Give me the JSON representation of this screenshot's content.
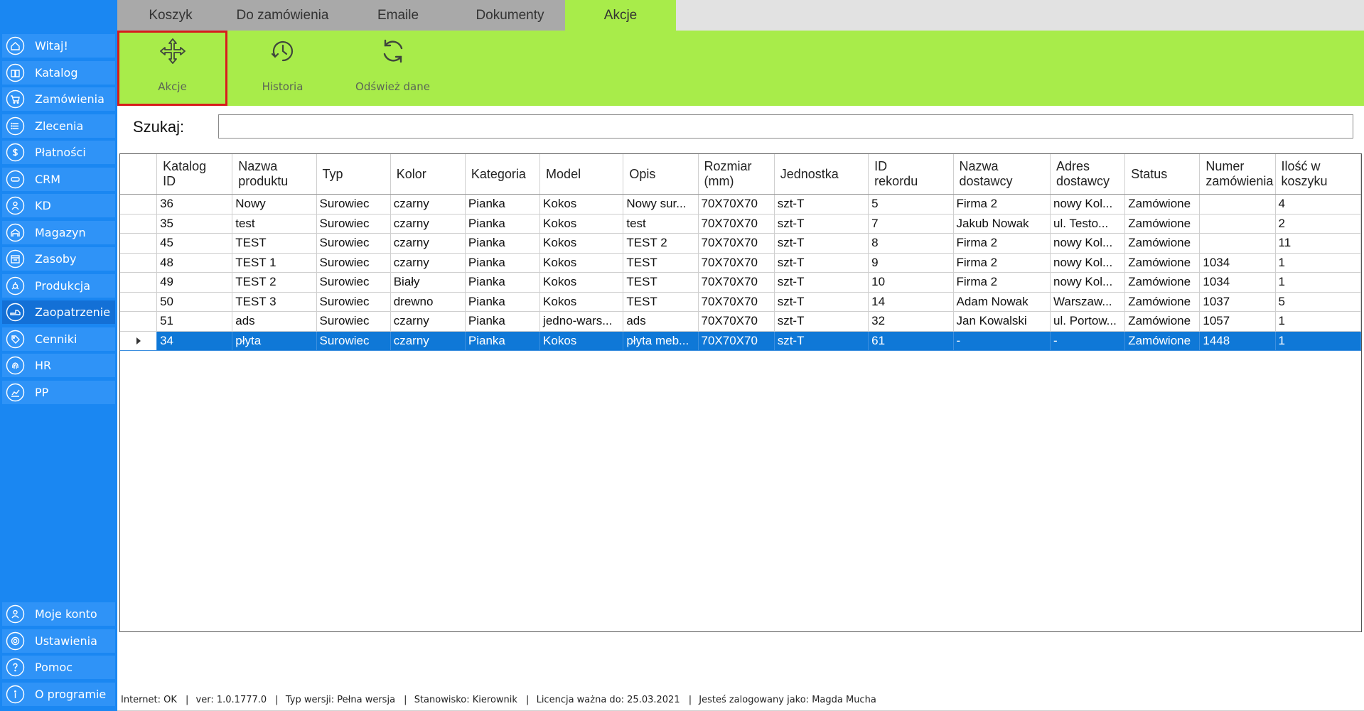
{
  "sidebar": {
    "top_items": [
      {
        "label": "Witaj!",
        "icon": "home-icon"
      },
      {
        "label": "Katalog",
        "icon": "book-icon"
      },
      {
        "label": "Zamówienia",
        "icon": "cart-icon"
      },
      {
        "label": "Zlecenia",
        "icon": "list-icon"
      },
      {
        "label": "Płatności",
        "icon": "dollar-icon"
      },
      {
        "label": "CRM",
        "icon": "crm-icon"
      },
      {
        "label": "KD",
        "icon": "user-icon"
      },
      {
        "label": "Magazyn",
        "icon": "warehouse-icon"
      },
      {
        "label": "Zasoby",
        "icon": "resources-icon"
      },
      {
        "label": "Produkcja",
        "icon": "production-icon"
      },
      {
        "label": "Zaopatrzenie",
        "icon": "supply-icon"
      },
      {
        "label": "Cenniki",
        "icon": "price-tag-icon"
      },
      {
        "label": "HR",
        "icon": "fingerprint-icon"
      },
      {
        "label": "PP",
        "icon": "chart-icon"
      }
    ],
    "bottom_items": [
      {
        "label": "Moje konto",
        "icon": "account-icon"
      },
      {
        "label": "Ustawienia",
        "icon": "settings-icon"
      },
      {
        "label": "Pomoc",
        "icon": "help-icon"
      },
      {
        "label": "O programie",
        "icon": "info-icon"
      }
    ],
    "active_item": "Zaopatrzenie"
  },
  "tabs": [
    "Koszyk",
    "Do zamówienia",
    "Emaile",
    "Dokumenty",
    "Akcje"
  ],
  "active_tab": "Akcje",
  "toolbar": {
    "buttons": [
      {
        "label": "Akcje",
        "icon": "move-arrows-icon"
      },
      {
        "label": "Historia",
        "icon": "history-icon"
      },
      {
        "label": "Odśwież dane",
        "icon": "refresh-icon"
      }
    ]
  },
  "search": {
    "label": "Szukaj:",
    "value": ""
  },
  "grid": {
    "columns": [
      {
        "line1": "Katalog",
        "line2": "ID"
      },
      {
        "line1": "Nazwa",
        "line2": "produktu"
      },
      {
        "line1": "Typ",
        "line2": ""
      },
      {
        "line1": "Kolor",
        "line2": ""
      },
      {
        "line1": "Kategoria",
        "line2": ""
      },
      {
        "line1": "Model",
        "line2": ""
      },
      {
        "line1": "Opis",
        "line2": ""
      },
      {
        "line1": "Rozmiar",
        "line2": "(mm)"
      },
      {
        "line1": "Jednostka",
        "line2": ""
      },
      {
        "line1": "ID",
        "line2": "rekordu"
      },
      {
        "line1": "Nazwa",
        "line2": "dostawcy"
      },
      {
        "line1": "Adres",
        "line2": "dostawcy"
      },
      {
        "line1": "Status",
        "line2": ""
      },
      {
        "line1": "Numer",
        "line2": "zamówienia"
      },
      {
        "line1": "Ilość w",
        "line2": "koszyku"
      }
    ],
    "rows": [
      [
        "36",
        "Nowy",
        "Surowiec",
        "czarny",
        "Pianka",
        "Kokos",
        "Nowy sur...",
        "70X70X70",
        "szt-T",
        "5",
        "Firma 2",
        "nowy Kol...",
        "Zamówione",
        "",
        "4"
      ],
      [
        "35",
        "test",
        "Surowiec",
        "czarny",
        "Pianka",
        "Kokos",
        "test",
        "70X70X70",
        "szt-T",
        "7",
        "Jakub Nowak",
        "ul. Testo...",
        "Zamówione",
        "",
        "2"
      ],
      [
        "45",
        "TEST",
        "Surowiec",
        "czarny",
        "Pianka",
        "Kokos",
        "TEST 2",
        "70X70X70",
        "szt-T",
        "8",
        "Firma 2",
        "nowy Kol...",
        "Zamówione",
        "",
        "11"
      ],
      [
        "48",
        "TEST 1",
        "Surowiec",
        "czarny",
        "Pianka",
        "Kokos",
        "TEST",
        "70X70X70",
        "szt-T",
        "9",
        "Firma 2",
        "nowy Kol...",
        "Zamówione",
        "1034",
        "1"
      ],
      [
        "49",
        "TEST 2",
        "Surowiec",
        "Biały",
        "Pianka",
        "Kokos",
        "TEST",
        "70X70X70",
        "szt-T",
        "10",
        "Firma 2",
        "nowy Kol...",
        "Zamówione",
        "1034",
        "1"
      ],
      [
        "50",
        "TEST 3",
        "Surowiec",
        "drewno",
        "Pianka",
        "Kokos",
        "TEST",
        "70X70X70",
        "szt-T",
        "14",
        "Adam Nowak",
        "Warszaw...",
        "Zamówione",
        "1037",
        "5"
      ],
      [
        "51",
        "ads",
        "Surowiec",
        "czarny",
        "Pianka",
        "jedno-wars...",
        "ads",
        "70X70X70",
        "szt-T",
        "32",
        "Jan Kowalski",
        "ul. Portow...",
        "Zamówione",
        "1057",
        "1"
      ],
      [
        "34",
        "płyta",
        "Surowiec",
        "czarny",
        "Pianka",
        "Kokos",
        "płyta meb...",
        "70X70X70",
        "szt-T",
        "61",
        "-",
        "-",
        "Zamówione",
        "1448",
        "1"
      ]
    ],
    "selected_row": 7
  },
  "statusbar": {
    "items": [
      "Internet: OK",
      "ver: 1.0.1777.0",
      "Typ wersji: Pełna wersja",
      "Stanowisko: Kierownik",
      "Licencja ważna do: 25.03.2021",
      "Jesteś zalogowany jako: Magda Mucha"
    ],
    "separator": "|"
  },
  "colors": {
    "sidebar_bg": "#1a87f2",
    "sidebar_item": "#2f93f7",
    "sidebar_active": "#1370d6",
    "accent_green": "#a8ec4a",
    "tab_inactive": "#a9a9a9",
    "selection_blue": "#0f78d7",
    "highlight_red": "#d71c1c"
  }
}
